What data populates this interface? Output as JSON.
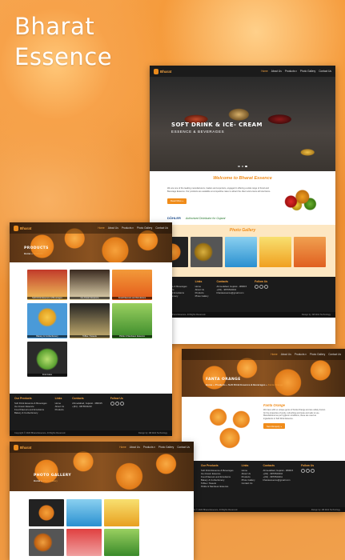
{
  "headline": {
    "line1": "Bharat",
    "line2": "Essence"
  },
  "brand": {
    "name": "Bharat"
  },
  "nav": [
    "Home",
    "About Us",
    "Products ▾",
    "Photo Gallery",
    "Contact Us"
  ],
  "home": {
    "hero_title": "SOFT DRINK & ICE- CREAM",
    "hero_sub": "ESSENCE & BEVERAGES",
    "welcome_title": "Welcome to Bharat Essence",
    "welcome_text": "We are one of the leading manufacturers, traders and exporters, engaged in offering a wide range of Food and Beverage Essence. Our products are available at competitive rates to attract the client and ensure all total items.",
    "read_more": "Read More »",
    "dohler_logo": "DÖHLER",
    "dohler_tag": "Authorised Distributor for Gujarat",
    "gallery_title": "Photo Gallery"
  },
  "products": {
    "page_title": "PRODUCTS",
    "crumb_home": "Home",
    "crumb_current": "Products",
    "items": [
      "Soft Drink Essence & Beverages",
      "Ice-Cream Essence",
      "Food Flavours and Emulsions",
      "Bakery & Confectionery",
      "Toffee / Sweets",
      "Pickle & Namkeen Essence",
      "Fruit Juice"
    ]
  },
  "fanta": {
    "page_title": "FANTA ORANGE",
    "crumb_home": "Home",
    "crumb_mid1": "Products",
    "crumb_mid2": "Soft Drink Essence & Beverages",
    "crumb_current": "Fanta Orange",
    "product_title": "Fanta Orange",
    "product_desc": "We have with us unique genre of Fanta Orange and are widely known for the properties of purity, refreshing and taste and safe to use. Manufactured as per hygienic conditions, these are used as ingredients in Soft Drink Essence.",
    "enquire": "Send Enquiry »"
  },
  "gallery": {
    "page_title": "PHOTO GALLERY",
    "crumb_home": "Home",
    "crumb_current": "Photo Gallery"
  },
  "footer": {
    "products_title": "Our Products",
    "products": [
      "Soft Drink Essence & Beverages",
      "Ice-Cream Essence",
      "Food Flavours and Emulsions",
      "Bakery & Confectionery",
      "Toffee / Sweets",
      "Pickle & Namkeen Essence",
      "Fruit Juice"
    ],
    "links_title": "Links",
    "links": [
      "Home",
      "About Us",
      "Products",
      "Photo Gallery",
      "Contact Us"
    ],
    "contact_title": "Contacts",
    "contact": [
      "Ahmedabad, Gujarat - 380015",
      "+(91) - 9876543210",
      "+(91) - 9876543211",
      "bharatessence@gmail.com"
    ],
    "follow_title": "Follow Us",
    "copyright": "Copyright © 2020 Bharat Essence. All Rights Reserved.",
    "design": "Design by: AB Web Technology"
  },
  "colors": {
    "accent": "#f08c1a",
    "dark": "#1b1b1b"
  }
}
